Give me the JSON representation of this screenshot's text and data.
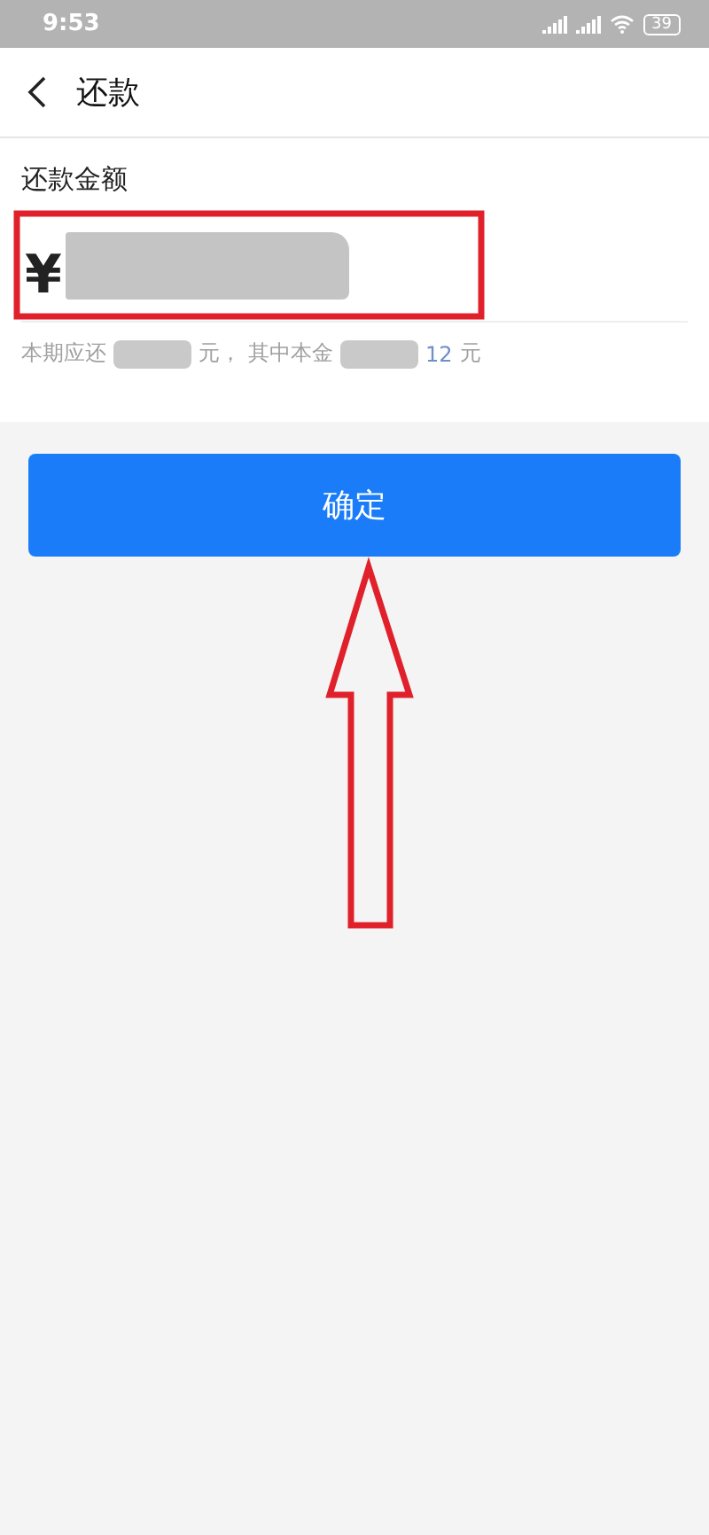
{
  "status_bar": {
    "time": "9:53",
    "battery": "39"
  },
  "header": {
    "title": "还款"
  },
  "form": {
    "label": "还款金额",
    "currency": "¥",
    "hint": [
      {
        "kind": "text",
        "text": "本期应还"
      },
      {
        "kind": "redacted"
      },
      {
        "kind": "text",
        "text": "元，"
      },
      {
        "kind": "text",
        "text": "其中本金"
      },
      {
        "kind": "redacted"
      },
      {
        "kind": "amount",
        "text": "12"
      },
      {
        "kind": "text",
        "text": "元"
      }
    ]
  },
  "confirm_button": {
    "label": "确定"
  }
}
